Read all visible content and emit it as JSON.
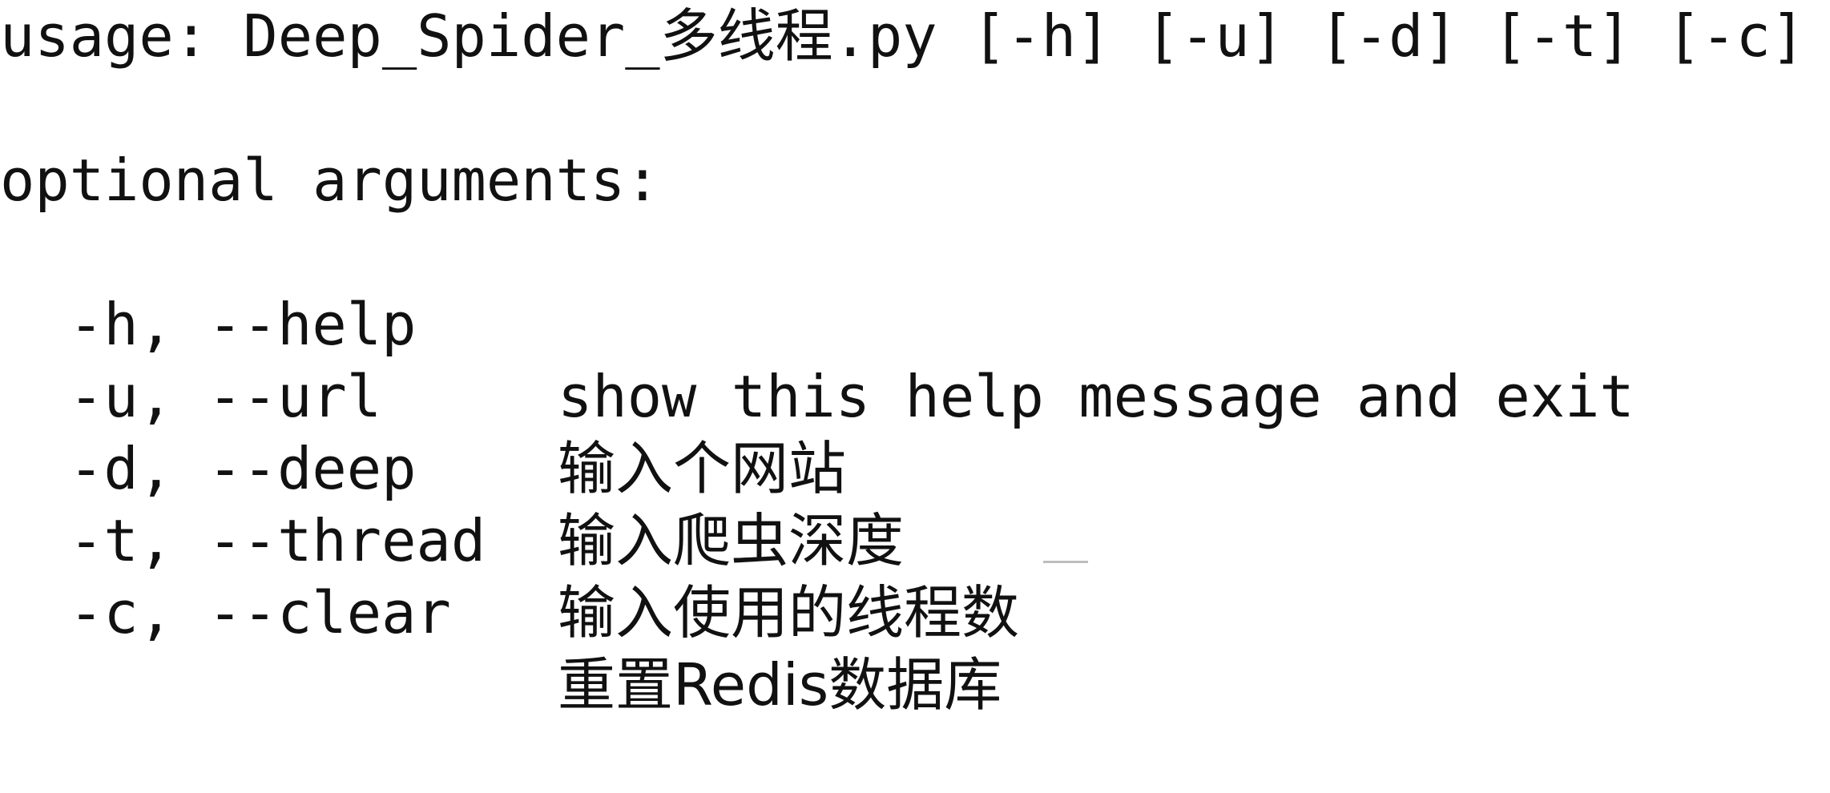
{
  "usage_line": "usage: Deep_Spider_多线程.py [-h] [-u] [-d] [-t] [-c]",
  "section_title": "optional arguments:",
  "options": [
    {
      "flags": "-h, --help",
      "help": "show this help message and exit"
    },
    {
      "flags": "-u, --url",
      "help": "输入个网站"
    },
    {
      "flags": "-d, --deep",
      "help": "输入爬虫深度"
    },
    {
      "flags": "-t, --thread",
      "help": "输入使用的线程数"
    },
    {
      "flags": "-c, --clear",
      "help": "重置Redis数据库"
    }
  ],
  "colors": {
    "background": "#ffffff",
    "text": "#111111"
  }
}
